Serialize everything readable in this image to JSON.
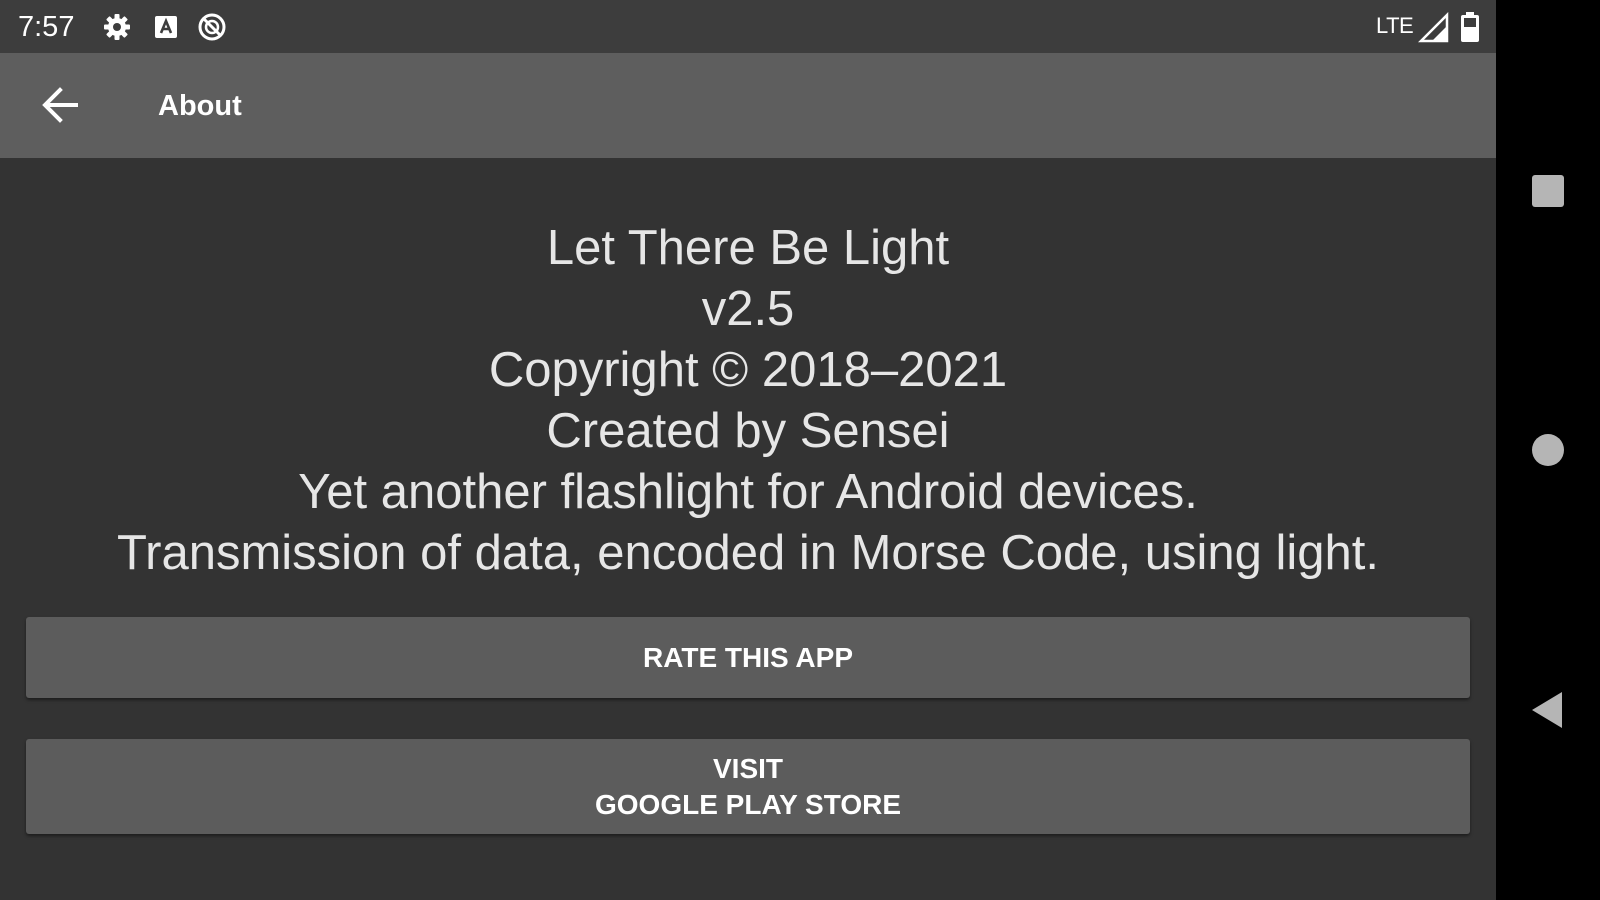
{
  "status_bar": {
    "time": "7:57",
    "icons": [
      "gear-icon",
      "a-box-icon",
      "sync-disabled-icon"
    ],
    "network": "LTE",
    "signal_icon": "signal-icon",
    "battery_icon": "battery-icon"
  },
  "app_bar": {
    "back_icon": "arrow-back-icon",
    "title": "About"
  },
  "about": {
    "app_name": "Let There Be Light",
    "version": "v2.5",
    "copyright": "Copyright © 2018–2021",
    "author": "Created by Sensei",
    "description": "Yet another flashlight for Android devices.",
    "feature": "Transmission of data, encoded in Morse Code, using light."
  },
  "buttons": {
    "rate_label": "RATE THIS APP",
    "visit_label_line1": "VISIT",
    "visit_label_line2": "GOOGLE PLAY STORE"
  },
  "nav_bar": {
    "items": [
      "recents-square-icon",
      "home-circle-icon",
      "back-triangle-icon"
    ]
  },
  "colors": {
    "screen_background": "#333333",
    "app_bar": "#5e5e5e",
    "status_bar": "#3d3d3d",
    "button": "#5c5c5c",
    "text_primary": "#e6e6e6",
    "nav_bar": "#000000"
  }
}
